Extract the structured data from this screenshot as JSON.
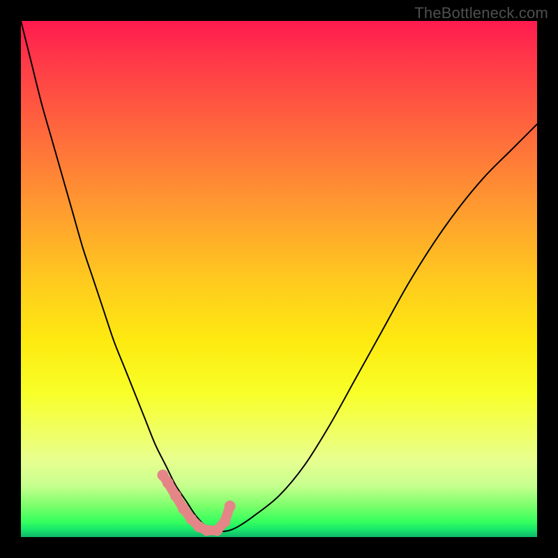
{
  "watermark": "TheBottleneck.com",
  "chart_data": {
    "type": "line",
    "title": "",
    "xlabel": "",
    "ylabel": "",
    "xlim": [
      0,
      100
    ],
    "ylim": [
      0,
      100
    ],
    "grid": false,
    "series": [
      {
        "name": "bottleneck-curve",
        "x": [
          0,
          2,
          4,
          6,
          8,
          10,
          12,
          14,
          16,
          18,
          20,
          22,
          24,
          26,
          28,
          30,
          32,
          34,
          36,
          38,
          40,
          42,
          45,
          50,
          55,
          60,
          65,
          70,
          75,
          80,
          85,
          90,
          95,
          100
        ],
        "values": [
          100,
          92,
          84,
          77,
          70,
          63,
          56,
          50,
          44,
          38,
          33,
          28,
          23,
          18,
          14,
          10,
          7,
          4,
          2,
          1.2,
          1.2,
          2,
          4,
          8,
          14,
          22,
          31,
          40,
          49,
          57,
          64,
          70,
          75,
          80
        ]
      }
    ],
    "markers": {
      "name": "threshold-band",
      "color": "#e48687",
      "x": [
        27.5,
        28.5,
        30.0,
        31.5,
        33.0,
        34.5,
        36.0,
        38.0,
        39.5,
        40.5
      ],
      "values": [
        12.0,
        10.5,
        8.0,
        5.5,
        3.5,
        2.0,
        1.3,
        1.3,
        3.0,
        6.0
      ]
    }
  },
  "colors": {
    "curve": "#000000",
    "marker": "#e48687",
    "background_top": "#ff1a4f",
    "background_mid": "#fdea10",
    "background_bottom": "#0fb66a",
    "frame": "#000000",
    "watermark": "#4f4f4f"
  }
}
